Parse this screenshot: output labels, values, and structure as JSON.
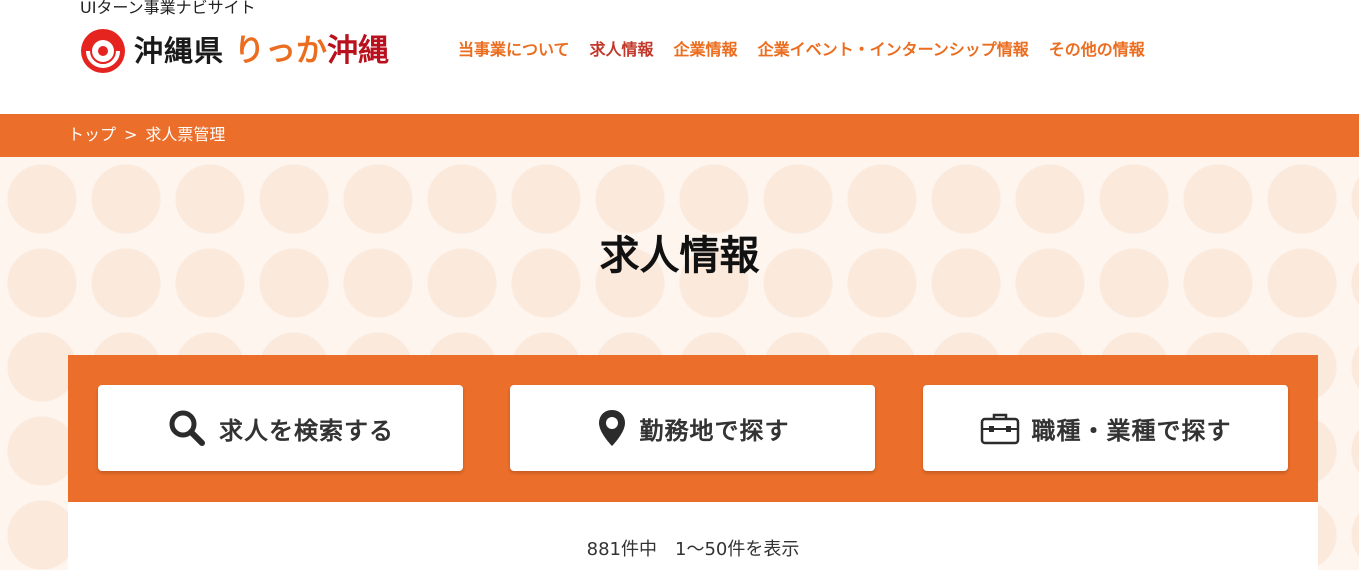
{
  "header": {
    "tagline": "UIターン事業ナビサイト",
    "logo_text": "沖縄県",
    "logo_brand_a": "りっか",
    "logo_brand_b": "沖縄",
    "nav": [
      {
        "label": "当事業について"
      },
      {
        "label": "求人情報"
      },
      {
        "label": "企業情報"
      },
      {
        "label": "企業イベント・インターンシップ情報"
      },
      {
        "label": "その他の情報"
      }
    ]
  },
  "breadcrumb": {
    "home": "トップ",
    "separator": ">",
    "current": "求人票管理"
  },
  "page": {
    "title": "求人情報"
  },
  "search": {
    "buttons": [
      {
        "label": "求人を検索する",
        "icon": "search-icon"
      },
      {
        "label": "勤務地で探す",
        "icon": "map-pin-icon"
      },
      {
        "label": "職種・業種で探す",
        "icon": "briefcase-icon"
      }
    ]
  },
  "results": {
    "count_text": "881件中　1〜50件を表示"
  },
  "colors": {
    "accent": "#eb6e2a",
    "nav_text": "#eb6d1f",
    "nav_active": "#c0392b",
    "hero_bg": "#fdf5ee",
    "hero_dot": "#fbe9dc"
  }
}
